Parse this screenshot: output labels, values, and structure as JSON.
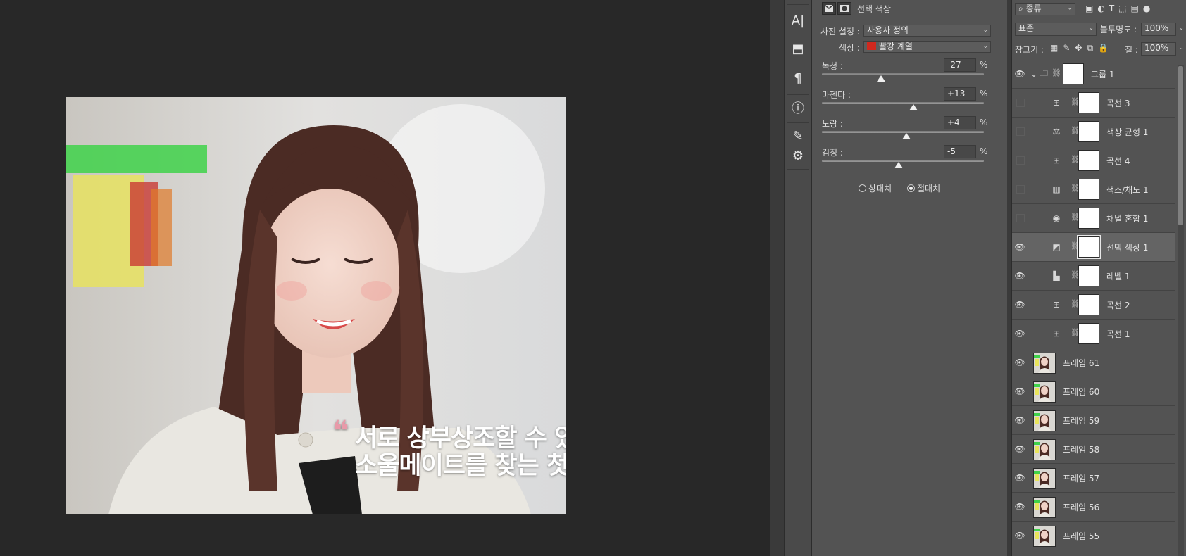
{
  "canvas": {
    "caption_line1": "서로 상부상조할 수 있",
    "caption_line2": "소울메이트를 찾는 첫",
    "quote_mark": "❝"
  },
  "icon_strip": [
    {
      "icon": "character-icon",
      "glyph": "A|"
    },
    {
      "icon": "glyphs-icon",
      "glyph": "⬒"
    },
    {
      "icon": "paragraph-icon",
      "glyph": "¶"
    },
    {
      "icon": "info-icon",
      "glyph": "ⓘ"
    },
    {
      "icon": "brush-icon",
      "glyph": "✎"
    },
    {
      "icon": "adjustments-icon",
      "glyph": "⚙"
    }
  ],
  "properties": {
    "title": "선택 색상",
    "preset_label": "사전 설정 :",
    "preset_value": "사용자 정의",
    "colors_label": "색상 :",
    "colors_value": "빨강 계열",
    "colors_swatch": "#d0281e",
    "sliders": [
      {
        "label": "녹청 :",
        "value": "-27",
        "unit": "%",
        "amount": -27
      },
      {
        "label": "마젠타 :",
        "value": "+13",
        "unit": "%",
        "amount": 13
      },
      {
        "label": "노랑 :",
        "value": "+4",
        "unit": "%",
        "amount": 4
      },
      {
        "label": "검정 :",
        "value": "-5",
        "unit": "%",
        "amount": -5
      }
    ],
    "method_relative": "상대치",
    "method_absolute": "절대치",
    "method_selected": "absolute"
  },
  "layers_panel": {
    "filter_label": "종류",
    "blend_mode": "표준",
    "opacity_label": "불투명도 :",
    "opacity_value": "100%",
    "lock_label": "잠그기 :",
    "fill_label": "칠 :",
    "fill_value": "100%",
    "layers": [
      {
        "name": "그룹 1",
        "kind": "group",
        "visible": true,
        "selected": false
      },
      {
        "name": "곡선 3",
        "kind": "curves",
        "visible": false,
        "selected": false
      },
      {
        "name": "색상 균형 1",
        "kind": "color-balance",
        "visible": false,
        "selected": false
      },
      {
        "name": "곡선 4",
        "kind": "curves",
        "visible": false,
        "selected": false
      },
      {
        "name": "색조/채도 1",
        "kind": "hue-saturation",
        "visible": false,
        "selected": false
      },
      {
        "name": "채널 혼합 1",
        "kind": "channel-mixer",
        "visible": false,
        "selected": false
      },
      {
        "name": "선택 색상 1",
        "kind": "selective-color",
        "visible": true,
        "selected": true
      },
      {
        "name": "레벨 1",
        "kind": "levels",
        "visible": true,
        "selected": false
      },
      {
        "name": "곡선 2",
        "kind": "curves",
        "visible": true,
        "selected": false
      },
      {
        "name": "곡선 1",
        "kind": "curves",
        "visible": true,
        "selected": false
      },
      {
        "name": "프레임 61",
        "kind": "frame",
        "visible": true,
        "selected": false
      },
      {
        "name": "프레임 60",
        "kind": "frame",
        "visible": true,
        "selected": false
      },
      {
        "name": "프레임 59",
        "kind": "frame",
        "visible": true,
        "selected": false
      },
      {
        "name": "프레임 58",
        "kind": "frame",
        "visible": true,
        "selected": false
      },
      {
        "name": "프레임 57",
        "kind": "frame",
        "visible": true,
        "selected": false
      },
      {
        "name": "프레임 56",
        "kind": "frame",
        "visible": true,
        "selected": false
      },
      {
        "name": "프레임 55",
        "kind": "frame",
        "visible": true,
        "selected": false
      }
    ]
  }
}
